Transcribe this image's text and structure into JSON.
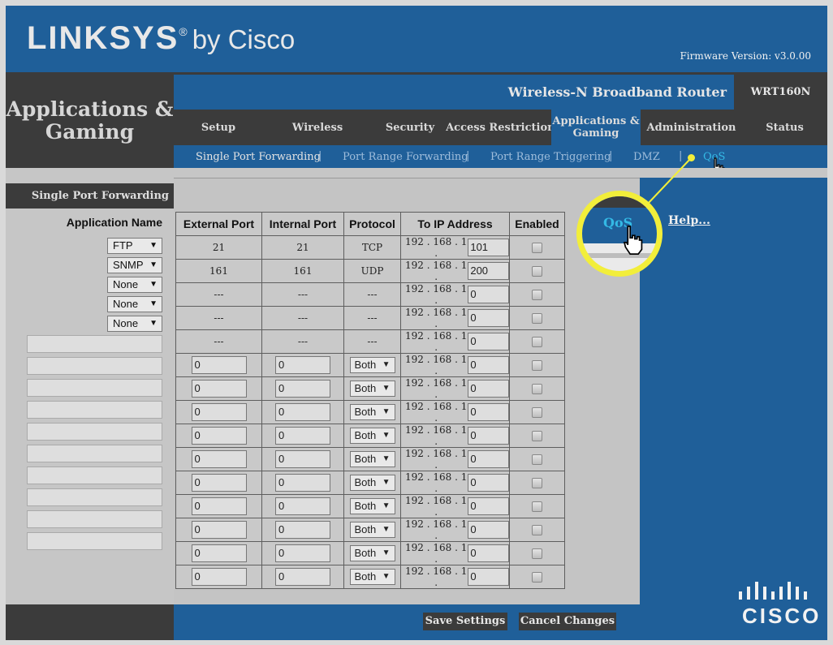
{
  "brand": {
    "logo_word": "LINKSYS",
    "logo_reg": "®",
    "logo_by": "by Cisco",
    "firmware": "Firmware Version: v3.0.00"
  },
  "section": {
    "title": "Applications & Gaming"
  },
  "product": {
    "name": "Wireless-N Broadband Router",
    "model": "WRT160N"
  },
  "tabs": [
    {
      "label": "Setup"
    },
    {
      "label": "Wireless"
    },
    {
      "label": "Security"
    },
    {
      "label": "Access Restrictions"
    },
    {
      "label": "Applications & Gaming"
    },
    {
      "label": "Administration"
    },
    {
      "label": "Status"
    }
  ],
  "subtabs": [
    {
      "label": "Single Port Forwarding"
    },
    {
      "label": "Port Range Forwarding"
    },
    {
      "label": "Port Range Triggering"
    },
    {
      "label": "DMZ"
    },
    {
      "label": "QoS"
    }
  ],
  "subtab_separator": "|",
  "left": {
    "header": "Single Port Forwarding",
    "app_name_header": "Application Name",
    "app_selects": [
      "FTP",
      "SNMP",
      "None",
      "None",
      "None"
    ]
  },
  "table": {
    "headers": [
      "External Port",
      "Internal Port",
      "Protocol",
      "To IP Address",
      "Enabled"
    ],
    "ip_prefix": "192 . 168 . 1 .",
    "fixed_rows": [
      {
        "ext": "21",
        "int": "21",
        "proto": "TCP",
        "ip": "101"
      },
      {
        "ext": "161",
        "int": "161",
        "proto": "UDP",
        "ip": "200"
      },
      {
        "ext": "---",
        "int": "---",
        "proto": "---",
        "ip": "0"
      },
      {
        "ext": "---",
        "int": "---",
        "proto": "---",
        "ip": "0"
      },
      {
        "ext": "---",
        "int": "---",
        "proto": "---",
        "ip": "0"
      }
    ],
    "custom_rows": [
      {
        "ext": "0",
        "int": "0",
        "proto": "Both",
        "ip": "0"
      },
      {
        "ext": "0",
        "int": "0",
        "proto": "Both",
        "ip": "0"
      },
      {
        "ext": "0",
        "int": "0",
        "proto": "Both",
        "ip": "0"
      },
      {
        "ext": "0",
        "int": "0",
        "proto": "Both",
        "ip": "0"
      },
      {
        "ext": "0",
        "int": "0",
        "proto": "Both",
        "ip": "0"
      },
      {
        "ext": "0",
        "int": "0",
        "proto": "Both",
        "ip": "0"
      },
      {
        "ext": "0",
        "int": "0",
        "proto": "Both",
        "ip": "0"
      },
      {
        "ext": "0",
        "int": "0",
        "proto": "Both",
        "ip": "0"
      },
      {
        "ext": "0",
        "int": "0",
        "proto": "Both",
        "ip": "0"
      },
      {
        "ext": "0",
        "int": "0",
        "proto": "Both",
        "ip": "0"
      }
    ]
  },
  "help": {
    "label": "Help..."
  },
  "buttons": {
    "save": "Save Settings",
    "cancel": "Cancel Changes"
  },
  "callout": {
    "label": "QoS"
  },
  "cisco": {
    "word": "CISCO"
  },
  "colors": {
    "blue": "#1f5f99",
    "dark": "#3b3b3b",
    "highlight": "#f2ee3a",
    "qos": "#34b9e5"
  }
}
